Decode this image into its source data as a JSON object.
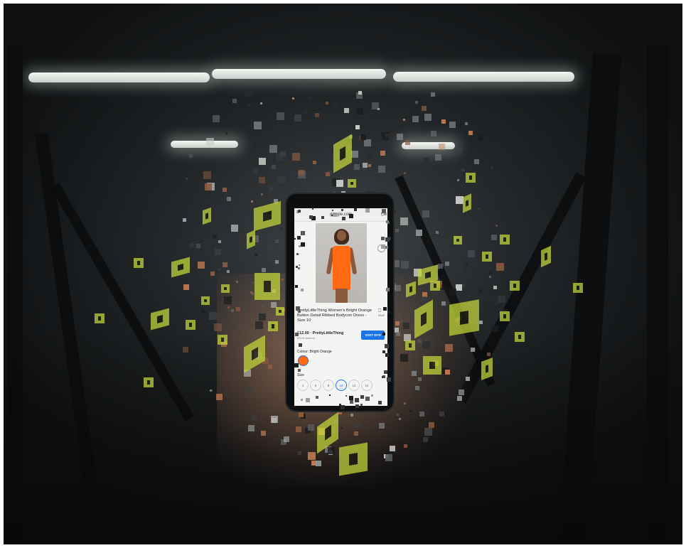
{
  "browser": {
    "url": "google.com",
    "reload_icon": "↻"
  },
  "product": {
    "title": "PrettyLittleThing Women's Bright Orange Button Detail Ribbed Bodycon Dress - Size 10",
    "price": "£12.00 · PrettyLittleThing",
    "delivery": "£3.99 delivery",
    "visit_label": "VISIT SITE",
    "save_label": "SAVE",
    "colour_label": "Colour: Bright Orange",
    "size_label": "Size",
    "sizes": [
      "4",
      "6",
      "8",
      "10",
      "12",
      "14"
    ],
    "selected_size": "10"
  },
  "colors": {
    "accent": "#1a73e8",
    "dress": "#ff6a13",
    "tile": "#c5d83a"
  }
}
